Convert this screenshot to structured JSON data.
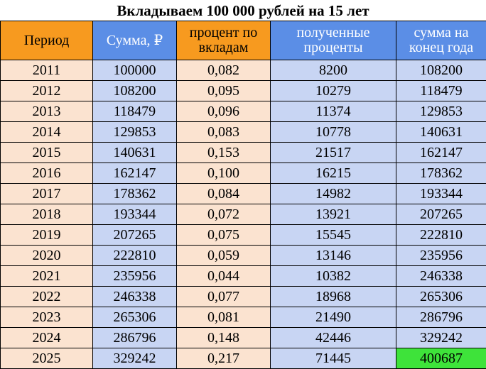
{
  "title": "Вкладываем 100 000 рублей на 15 лет",
  "headers": [
    {
      "lines": [
        "Период"
      ]
    },
    {
      "lines": [
        "Сумма, ₽"
      ]
    },
    {
      "lines": [
        "процент по",
        "вкладам"
      ]
    },
    {
      "lines": [
        "полученные",
        "проценты"
      ]
    },
    {
      "lines": [
        "сумма на",
        "конец года"
      ]
    }
  ],
  "rows": [
    [
      "2011",
      "100000",
      "0,082",
      "8200",
      "108200"
    ],
    [
      "2012",
      "108200",
      "0,095",
      "10279",
      "118479"
    ],
    [
      "2013",
      "118479",
      "0,096",
      "11374",
      "129853"
    ],
    [
      "2014",
      "129853",
      "0,083",
      "10778",
      "140631"
    ],
    [
      "2015",
      "140631",
      "0,153",
      "21517",
      "162147"
    ],
    [
      "2016",
      "162147",
      "0,100",
      "16215",
      "178362"
    ],
    [
      "2017",
      "178362",
      "0,084",
      "14982",
      "193344"
    ],
    [
      "2018",
      "193344",
      "0,072",
      "13921",
      "207265"
    ],
    [
      "2019",
      "207265",
      "0,075",
      "15545",
      "222810"
    ],
    [
      "2020",
      "222810",
      "0,059",
      "13146",
      "235956"
    ],
    [
      "2021",
      "235956",
      "0,044",
      "10382",
      "246338"
    ],
    [
      "2022",
      "246338",
      "0,077",
      "18968",
      "265306"
    ],
    [
      "2023",
      "265306",
      "0,081",
      "21490",
      "286796"
    ],
    [
      "2024",
      "286796",
      "0,148",
      "42446",
      "329242"
    ],
    [
      "2025",
      "329242",
      "0,217",
      "71445",
      "400687"
    ]
  ],
  "colors": {
    "header_orange": "#f79a1f",
    "header_blue": "#5b8ee6",
    "cell_peach": "#fbe3d0",
    "cell_blue": "#c8d5f3",
    "final_highlight": "#3ee33a"
  }
}
